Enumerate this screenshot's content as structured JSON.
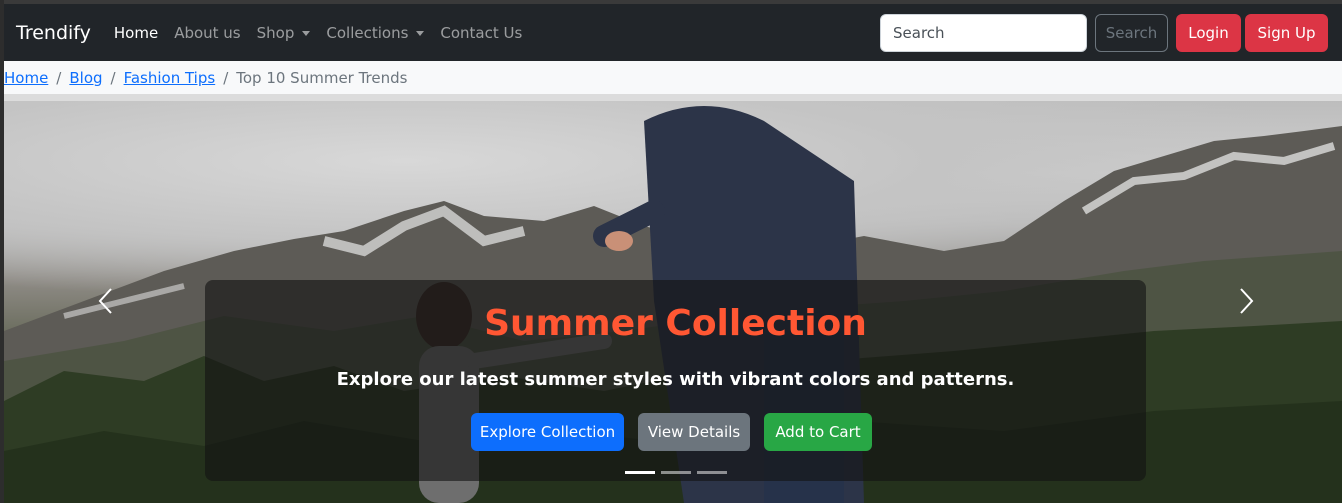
{
  "navbar": {
    "brand": "Trendify",
    "links": [
      {
        "label": "Home",
        "active": true,
        "dropdown": false
      },
      {
        "label": "About us",
        "active": false,
        "dropdown": false
      },
      {
        "label": "Shop",
        "active": false,
        "dropdown": true
      },
      {
        "label": "Collections",
        "active": false,
        "dropdown": true
      },
      {
        "label": "Contact Us",
        "active": false,
        "dropdown": false
      }
    ],
    "search_placeholder": "Search",
    "search_button": "Search",
    "login": "Login",
    "signup": "Sign Up"
  },
  "breadcrumb": {
    "items": [
      "Home",
      "Blog",
      "Fashion Tips"
    ],
    "current": "Top 10 Summer Trends",
    "separator": "/"
  },
  "carousel": {
    "title": "Summer Collection",
    "subtitle": "Explore our latest summer styles with vibrant colors and patterns.",
    "buttons": {
      "explore": "Explore Collection",
      "details": "View Details",
      "cart": "Add to Cart"
    },
    "indicator_count": 3,
    "active_indicator": 0,
    "colors": {
      "title": "#ff5733",
      "primary": "#0d6efd",
      "secondary": "#6c757d",
      "success": "#28a745"
    }
  },
  "icons": {
    "prev": "chevron-left-icon",
    "next": "chevron-right-icon",
    "caret": "caret-down-icon"
  }
}
